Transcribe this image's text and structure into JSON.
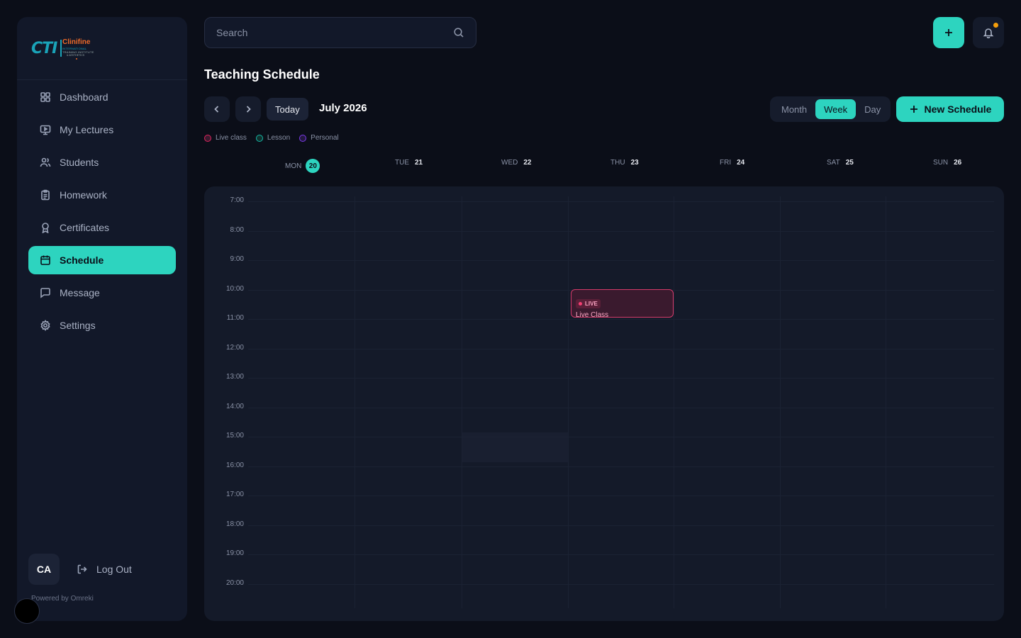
{
  "sidebar": {
    "logo": {
      "mark": "CTI",
      "name": "Clinifine",
      "sub1": "INTERNATIONAL",
      "sub2": "TRAINING INSTITUTE",
      "sub3": "& AESTHETICS"
    },
    "items": [
      {
        "label": "Dashboard",
        "icon": "grid-icon"
      },
      {
        "label": "My Lectures",
        "icon": "monitor-play-icon"
      },
      {
        "label": "Students",
        "icon": "users-icon"
      },
      {
        "label": "Homework",
        "icon": "clipboard-icon"
      },
      {
        "label": "Certificates",
        "icon": "award-icon"
      },
      {
        "label": "Schedule",
        "icon": "calendar-icon",
        "active": true
      },
      {
        "label": "Message",
        "icon": "message-icon"
      },
      {
        "label": "Settings",
        "icon": "gear-icon"
      }
    ],
    "user_initials": "CA",
    "logout_label": "Log Out",
    "powered_by": "Powered by Omreki"
  },
  "search": {
    "placeholder": "Search"
  },
  "page_title": "Teaching Schedule",
  "toolbar": {
    "today_label": "Today",
    "month_label": "July 2026",
    "views": [
      "Month",
      "Week",
      "Day"
    ],
    "active_view": "Week",
    "new_button_label": "New Schedule"
  },
  "legend": [
    {
      "label": "Live class",
      "color": "#e0245e"
    },
    {
      "label": "Lesson",
      "color": "#14b8a6"
    },
    {
      "label": "Personal",
      "color": "#7c3aed"
    }
  ],
  "days": [
    {
      "dow": "MON",
      "num": "20",
      "today": true
    },
    {
      "dow": "TUE",
      "num": "21"
    },
    {
      "dow": "WED",
      "num": "22"
    },
    {
      "dow": "THU",
      "num": "23"
    },
    {
      "dow": "FRI",
      "num": "24"
    },
    {
      "dow": "SAT",
      "num": "25"
    },
    {
      "dow": "SUN",
      "num": "26"
    }
  ],
  "hours": [
    "7:00",
    "8:00",
    "9:00",
    "10:00",
    "11:00",
    "12:00",
    "13:00",
    "14:00",
    "15:00",
    "16:00",
    "17:00",
    "18:00",
    "19:00",
    "20:00"
  ],
  "event": {
    "badge": "LIVE",
    "title": "Live Class",
    "day": "THU",
    "start": "10:00",
    "end": "11:00"
  },
  "colors": {
    "accent": "#2dd4bf",
    "background": "#0b0e18",
    "panel": "#121829",
    "notification": "#f59e0b",
    "live": "#d43a6a"
  }
}
